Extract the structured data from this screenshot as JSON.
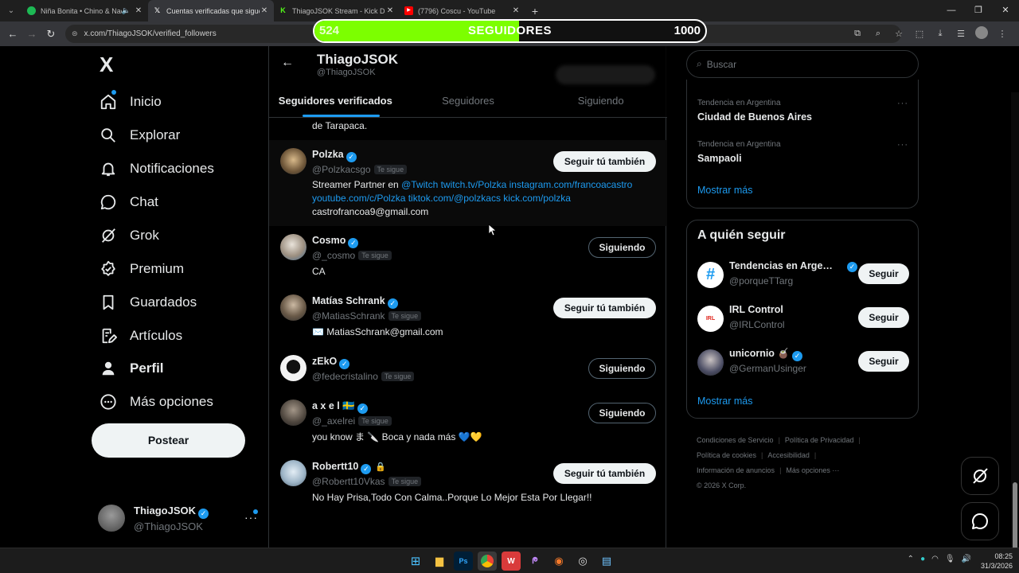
{
  "browser": {
    "tabs": [
      {
        "title": "Niña Bonita • Chino & Nacho",
        "icon": "spotify-icon",
        "color": "#1db954",
        "active": false
      },
      {
        "title": "Cuentas verificadas que siguen",
        "icon": "x-icon",
        "color": "#ffffff",
        "active": true
      },
      {
        "title": "ThiagoJSOK Stream - Kick Dashb",
        "icon": "kick-icon",
        "color": "#53fc18",
        "active": false
      },
      {
        "title": "(7796) Coscu - YouTube",
        "icon": "youtube-icon",
        "color": "#ff0000",
        "active": false
      }
    ],
    "url": "x.com/ThiagoJSOK/verified_followers"
  },
  "overlay": {
    "current": "524",
    "label": "SEGUIDORES",
    "goal": "1000",
    "progress": 0.524,
    "fill_color": "#7cff00"
  },
  "nav": {
    "logo": "X",
    "items": [
      {
        "label": "Inicio",
        "icon": "home-icon"
      },
      {
        "label": "Explorar",
        "icon": "search-icon"
      },
      {
        "label": "Notificaciones",
        "icon": "bell-icon"
      },
      {
        "label": "Chat",
        "icon": "chat-icon"
      },
      {
        "label": "Grok",
        "icon": "grok-icon"
      },
      {
        "label": "Premium",
        "icon": "premium-icon"
      },
      {
        "label": "Guardados",
        "icon": "bookmark-icon"
      },
      {
        "label": "Artículos",
        "icon": "articles-icon"
      },
      {
        "label": "Perfil",
        "icon": "profile-icon"
      },
      {
        "label": "Más opciones",
        "icon": "more-icon"
      }
    ],
    "post_label": "Postear",
    "profile": {
      "name": "ThiagoJSOK",
      "handle": "@ThiagoJSOK"
    }
  },
  "main": {
    "name": "ThiagoJSOK",
    "handle": "@ThiagoJSOK",
    "tabs": [
      "Seguidores verificados",
      "Seguidores",
      "Siguiendo"
    ],
    "partial_text": "de Tarapaca.",
    "follows_you": "Te sigue",
    "users": [
      {
        "name": "Polzka",
        "handle": "@Polzkacsgo",
        "button": "Seguir tú también",
        "bio_plain": "Streamer Partner en ",
        "bio_links": "@Twitch twitch.tv/Polzka instagram.com/francoacastro",
        "bio_links2": "youtube.com/c/Polzka tiktok.com/@polzkacs kick.com/polzka",
        "bio_line3": "castrofrancoa9@gmail.com"
      },
      {
        "name": "Cosmo",
        "handle": "@_cosmo",
        "button": "Siguiendo",
        "bio": "CA"
      },
      {
        "name": "Matías Schrank",
        "handle": "@MatiasSchrank",
        "button": "Seguir tú también",
        "bio": "✉️ MatiasSchrank@gmail.com"
      },
      {
        "name": "zEkO",
        "handle": "@fedecristalino",
        "button": "Siguiendo",
        "bio": ""
      },
      {
        "name": "a x e l 🇸🇪",
        "handle": "@_axelrei",
        "button": "Siguiendo",
        "bio": "you know ま 🔪 Boca y nada más 💙💛"
      },
      {
        "name": "Robertt10",
        "handle": "@Robertt10Vkas",
        "button": "Seguir tú también",
        "bio": "No Hay Prisa,Todo Con Calma..Porque Lo Mejor Esta Por Llegar!!"
      }
    ]
  },
  "sidebar": {
    "search_placeholder": "Buscar",
    "trends": [
      {
        "context": "Tendencia en Argentina",
        "name": "Ciudad de Buenos Aires"
      },
      {
        "context": "Tendencia en Argentina",
        "name": "Sampaoli"
      }
    ],
    "show_more": "Mostrar más",
    "who_title": "A quién seguir",
    "who": [
      {
        "name": "Tendencias en Argentina",
        "handle": "@porqueTTarg",
        "button": "Seguir"
      },
      {
        "name": "IRL Control",
        "handle": "@IRLControl",
        "button": "Seguir"
      },
      {
        "name": "unicornio 🧉",
        "handle": "@GermanUsinger",
        "button": "Seguir"
      }
    ],
    "footer": {
      "links": [
        "Condiciones de Servicio",
        "Política de Privacidad",
        "Política de cookies",
        "Accesibilidad",
        "Información de anuncios",
        "Más opciones ···"
      ],
      "copyright": "© 2026 X Corp."
    }
  },
  "taskbar": {
    "time": "08:25",
    "date": "31/3/2026"
  }
}
